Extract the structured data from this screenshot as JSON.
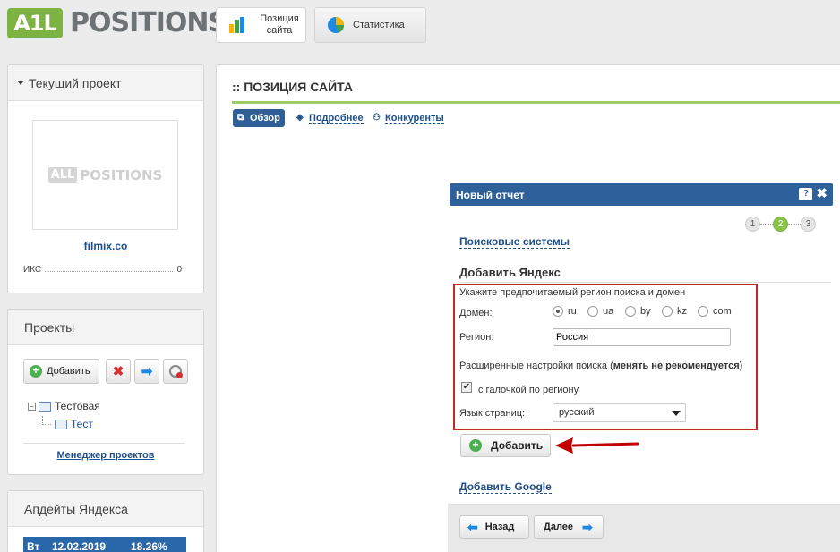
{
  "header": {
    "logo_badge": "A1L",
    "logo_text": "POSITIONS",
    "tabs": [
      {
        "label": "Позиция сайта",
        "icon": "bar-chart-icon"
      },
      {
        "label": "Статистика",
        "icon": "pie-chart-icon"
      }
    ]
  },
  "current_project": {
    "title": "Текущий проект",
    "placeholder_logo": {
      "badge": "ALL",
      "text": "POSITIONS"
    },
    "site_link": "filmix.co",
    "iks_label": "ИКС",
    "iks_value": "0"
  },
  "projects": {
    "title": "Проекты",
    "add_label": "Добавить",
    "tree": {
      "group": "Тестовая",
      "item": "Тест"
    },
    "manager_link": "Менеджер проектов"
  },
  "yandex_updates": {
    "title": "Апдейты Яндекса",
    "row": {
      "day": "Вт",
      "date": "12.02.2019",
      "percent": "18.26%"
    }
  },
  "main": {
    "title": ":: ПОЗИЦИЯ САЙТА",
    "subtabs": [
      "Обзор",
      "Подробнее",
      "Конкуренты"
    ]
  },
  "dialog": {
    "title": "Новый отчет",
    "steps": [
      "1",
      "2",
      "3"
    ],
    "search_systems_link": "Поисковые системы",
    "section_title": "Добавить Яндекс",
    "hint": "Укажите предпочитаемый регион поиска и домен",
    "domain_label": "Домен:",
    "domains": [
      "ru",
      "ua",
      "by",
      "kz",
      "com"
    ],
    "domain_selected": "ru",
    "region_label": "Регион:",
    "region_value": "Россия",
    "advanced_label": "Расширенные настройки поиска",
    "advanced_open": "(",
    "advanced_warning": "менять не рекомендуется",
    "advanced_close": ")",
    "region_checkbox_label": "с галочкой по региону",
    "lang_label": "Язык страниц:",
    "lang_value": "русский",
    "add_button": "Добавить",
    "add_google_link": "Добавить Google",
    "back_button": "Назад",
    "next_button": "Далее",
    "arrow_color": "#c00000"
  }
}
